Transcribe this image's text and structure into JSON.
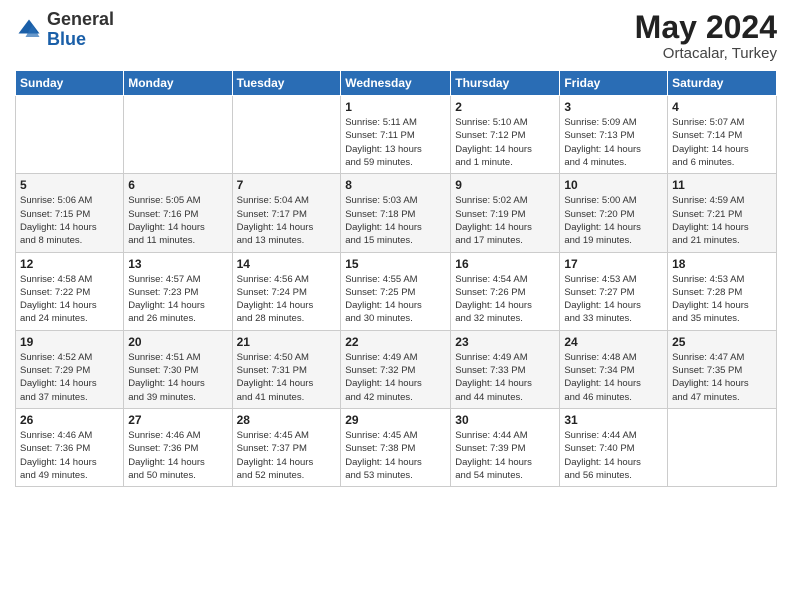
{
  "header": {
    "logo_general": "General",
    "logo_blue": "Blue",
    "month_year": "May 2024",
    "location": "Ortacalar, Turkey"
  },
  "days_of_week": [
    "Sunday",
    "Monday",
    "Tuesday",
    "Wednesday",
    "Thursday",
    "Friday",
    "Saturday"
  ],
  "weeks": [
    [
      {
        "day": "",
        "sunrise": "",
        "sunset": "",
        "daylight": ""
      },
      {
        "day": "",
        "sunrise": "",
        "sunset": "",
        "daylight": ""
      },
      {
        "day": "",
        "sunrise": "",
        "sunset": "",
        "daylight": ""
      },
      {
        "day": "1",
        "sunrise": "Sunrise: 5:11 AM",
        "sunset": "Sunset: 7:11 PM",
        "daylight": "Daylight: 13 hours and 59 minutes."
      },
      {
        "day": "2",
        "sunrise": "Sunrise: 5:10 AM",
        "sunset": "Sunset: 7:12 PM",
        "daylight": "Daylight: 14 hours and 1 minute."
      },
      {
        "day": "3",
        "sunrise": "Sunrise: 5:09 AM",
        "sunset": "Sunset: 7:13 PM",
        "daylight": "Daylight: 14 hours and 4 minutes."
      },
      {
        "day": "4",
        "sunrise": "Sunrise: 5:07 AM",
        "sunset": "Sunset: 7:14 PM",
        "daylight": "Daylight: 14 hours and 6 minutes."
      }
    ],
    [
      {
        "day": "5",
        "sunrise": "Sunrise: 5:06 AM",
        "sunset": "Sunset: 7:15 PM",
        "daylight": "Daylight: 14 hours and 8 minutes."
      },
      {
        "day": "6",
        "sunrise": "Sunrise: 5:05 AM",
        "sunset": "Sunset: 7:16 PM",
        "daylight": "Daylight: 14 hours and 11 minutes."
      },
      {
        "day": "7",
        "sunrise": "Sunrise: 5:04 AM",
        "sunset": "Sunset: 7:17 PM",
        "daylight": "Daylight: 14 hours and 13 minutes."
      },
      {
        "day": "8",
        "sunrise": "Sunrise: 5:03 AM",
        "sunset": "Sunset: 7:18 PM",
        "daylight": "Daylight: 14 hours and 15 minutes."
      },
      {
        "day": "9",
        "sunrise": "Sunrise: 5:02 AM",
        "sunset": "Sunset: 7:19 PM",
        "daylight": "Daylight: 14 hours and 17 minutes."
      },
      {
        "day": "10",
        "sunrise": "Sunrise: 5:00 AM",
        "sunset": "Sunset: 7:20 PM",
        "daylight": "Daylight: 14 hours and 19 minutes."
      },
      {
        "day": "11",
        "sunrise": "Sunrise: 4:59 AM",
        "sunset": "Sunset: 7:21 PM",
        "daylight": "Daylight: 14 hours and 21 minutes."
      }
    ],
    [
      {
        "day": "12",
        "sunrise": "Sunrise: 4:58 AM",
        "sunset": "Sunset: 7:22 PM",
        "daylight": "Daylight: 14 hours and 24 minutes."
      },
      {
        "day": "13",
        "sunrise": "Sunrise: 4:57 AM",
        "sunset": "Sunset: 7:23 PM",
        "daylight": "Daylight: 14 hours and 26 minutes."
      },
      {
        "day": "14",
        "sunrise": "Sunrise: 4:56 AM",
        "sunset": "Sunset: 7:24 PM",
        "daylight": "Daylight: 14 hours and 28 minutes."
      },
      {
        "day": "15",
        "sunrise": "Sunrise: 4:55 AM",
        "sunset": "Sunset: 7:25 PM",
        "daylight": "Daylight: 14 hours and 30 minutes."
      },
      {
        "day": "16",
        "sunrise": "Sunrise: 4:54 AM",
        "sunset": "Sunset: 7:26 PM",
        "daylight": "Daylight: 14 hours and 32 minutes."
      },
      {
        "day": "17",
        "sunrise": "Sunrise: 4:53 AM",
        "sunset": "Sunset: 7:27 PM",
        "daylight": "Daylight: 14 hours and 33 minutes."
      },
      {
        "day": "18",
        "sunrise": "Sunrise: 4:53 AM",
        "sunset": "Sunset: 7:28 PM",
        "daylight": "Daylight: 14 hours and 35 minutes."
      }
    ],
    [
      {
        "day": "19",
        "sunrise": "Sunrise: 4:52 AM",
        "sunset": "Sunset: 7:29 PM",
        "daylight": "Daylight: 14 hours and 37 minutes."
      },
      {
        "day": "20",
        "sunrise": "Sunrise: 4:51 AM",
        "sunset": "Sunset: 7:30 PM",
        "daylight": "Daylight: 14 hours and 39 minutes."
      },
      {
        "day": "21",
        "sunrise": "Sunrise: 4:50 AM",
        "sunset": "Sunset: 7:31 PM",
        "daylight": "Daylight: 14 hours and 41 minutes."
      },
      {
        "day": "22",
        "sunrise": "Sunrise: 4:49 AM",
        "sunset": "Sunset: 7:32 PM",
        "daylight": "Daylight: 14 hours and 42 minutes."
      },
      {
        "day": "23",
        "sunrise": "Sunrise: 4:49 AM",
        "sunset": "Sunset: 7:33 PM",
        "daylight": "Daylight: 14 hours and 44 minutes."
      },
      {
        "day": "24",
        "sunrise": "Sunrise: 4:48 AM",
        "sunset": "Sunset: 7:34 PM",
        "daylight": "Daylight: 14 hours and 46 minutes."
      },
      {
        "day": "25",
        "sunrise": "Sunrise: 4:47 AM",
        "sunset": "Sunset: 7:35 PM",
        "daylight": "Daylight: 14 hours and 47 minutes."
      }
    ],
    [
      {
        "day": "26",
        "sunrise": "Sunrise: 4:46 AM",
        "sunset": "Sunset: 7:36 PM",
        "daylight": "Daylight: 14 hours and 49 minutes."
      },
      {
        "day": "27",
        "sunrise": "Sunrise: 4:46 AM",
        "sunset": "Sunset: 7:36 PM",
        "daylight": "Daylight: 14 hours and 50 minutes."
      },
      {
        "day": "28",
        "sunrise": "Sunrise: 4:45 AM",
        "sunset": "Sunset: 7:37 PM",
        "daylight": "Daylight: 14 hours and 52 minutes."
      },
      {
        "day": "29",
        "sunrise": "Sunrise: 4:45 AM",
        "sunset": "Sunset: 7:38 PM",
        "daylight": "Daylight: 14 hours and 53 minutes."
      },
      {
        "day": "30",
        "sunrise": "Sunrise: 4:44 AM",
        "sunset": "Sunset: 7:39 PM",
        "daylight": "Daylight: 14 hours and 54 minutes."
      },
      {
        "day": "31",
        "sunrise": "Sunrise: 4:44 AM",
        "sunset": "Sunset: 7:40 PM",
        "daylight": "Daylight: 14 hours and 56 minutes."
      },
      {
        "day": "",
        "sunrise": "",
        "sunset": "",
        "daylight": ""
      }
    ]
  ]
}
